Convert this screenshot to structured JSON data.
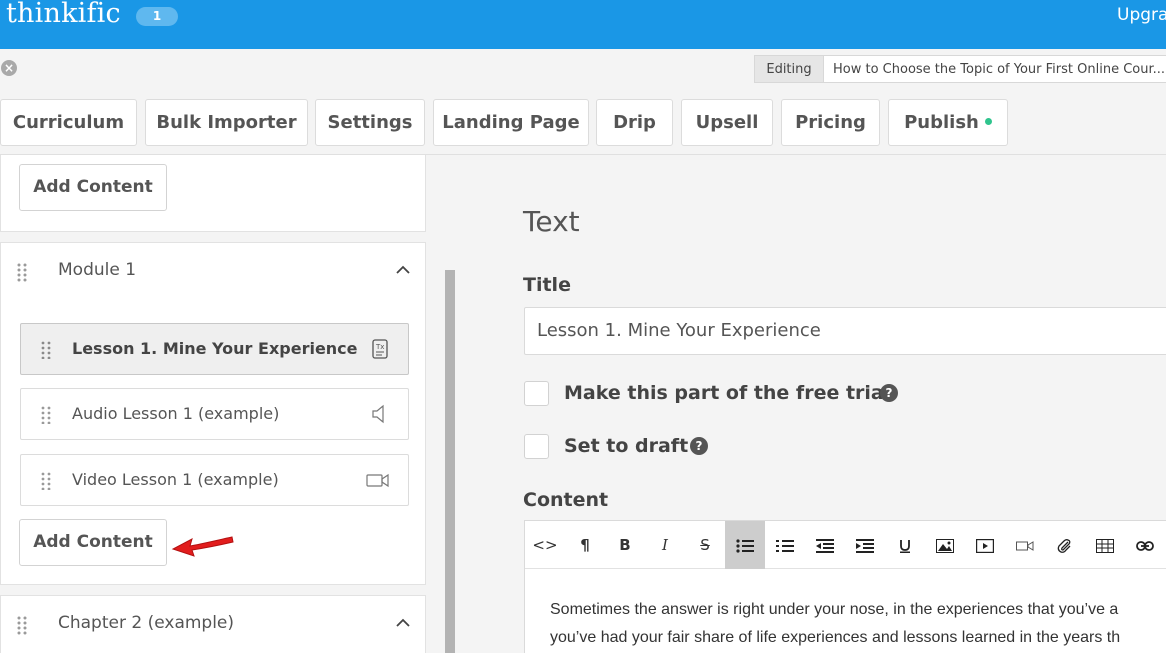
{
  "header": {
    "logo": "thinkific",
    "badge_count": "1",
    "upgrade_label": "Upgra"
  },
  "subbar": {
    "close_symbol": "×",
    "editing_label": "Editing",
    "course_title": "How to Choose the Topic of Your First Online Cour..."
  },
  "tabs": [
    {
      "label": "Curriculum"
    },
    {
      "label": "Bulk Importer"
    },
    {
      "label": "Settings"
    },
    {
      "label": "Landing Page"
    },
    {
      "label": "Drip"
    },
    {
      "label": "Upsell"
    },
    {
      "label": "Pricing"
    },
    {
      "label": "Publish"
    }
  ],
  "sidebar": {
    "top_add_label": "Add Content",
    "module": {
      "title": "Module 1",
      "lessons": [
        {
          "label": "Lesson 1. Mine Your Experience",
          "icon": "text-lesson-icon"
        },
        {
          "label": "Audio Lesson 1 (example)",
          "icon": "speaker-icon"
        },
        {
          "label": "Video Lesson 1 (example)",
          "icon": "video-camera-icon"
        }
      ],
      "add_label": "Add Content"
    },
    "chapter2": {
      "title": "Chapter 2 (example)"
    }
  },
  "main": {
    "heading": "Text",
    "title_label": "Title",
    "title_value": "Lesson 1. Mine Your Experience",
    "free_trial_label": "Make this part of the free trial",
    "draft_label": "Set to draft",
    "help_symbol": "?",
    "content_label": "Content",
    "toolbar": [
      {
        "name": "code-view",
        "glyph": "<>"
      },
      {
        "name": "paragraph",
        "glyph": "¶"
      },
      {
        "name": "bold",
        "glyph": "B"
      },
      {
        "name": "italic",
        "glyph": "I"
      },
      {
        "name": "strikethrough",
        "glyph": "S"
      }
    ],
    "content_lines": [
      "Sometimes the answer is right under your nose, in the experiences that you’ve a",
      "you’ve had your fair share of life experiences and lessons learned in the years th"
    ]
  },
  "colors": {
    "topbar": "#1a97e6",
    "publish_dot": "#2fc48d",
    "arrow": "#e21d1d"
  }
}
